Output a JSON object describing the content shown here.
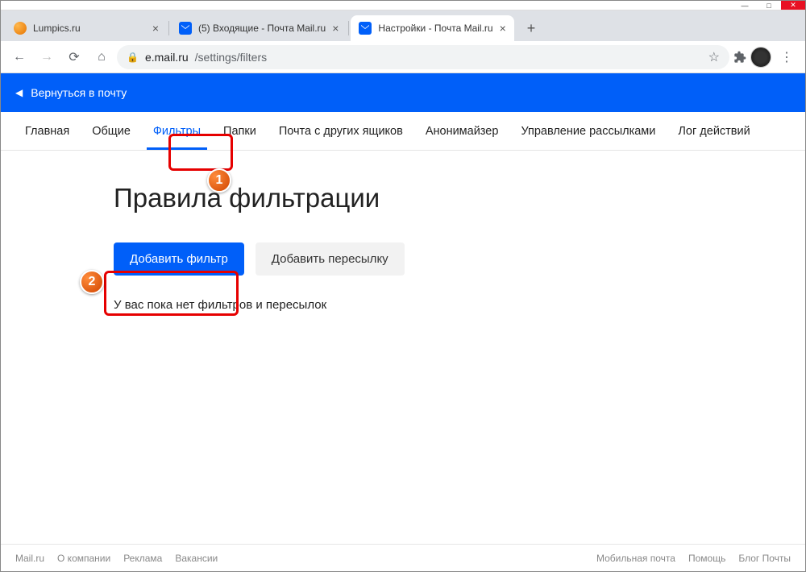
{
  "window": {
    "minimize": "—",
    "maximize": "□",
    "close": "✕"
  },
  "tabs": [
    {
      "title": "Lumpics.ru",
      "favicon": "orange",
      "active": false
    },
    {
      "title": "(5) Входящие - Почта Mail.ru",
      "favicon": "mail",
      "active": false
    },
    {
      "title": "Настройки - Почта Mail.ru",
      "favicon": "mail",
      "active": true
    }
  ],
  "newtab_label": "+",
  "address": {
    "host": "e.mail.ru",
    "path": "/settings/filters",
    "star": "☆"
  },
  "blueheader": {
    "arrow": "◀",
    "label": "Вернуться в почту"
  },
  "settings_tabs": [
    "Главная",
    "Общие",
    "Фильтры",
    "Папки",
    "Почта с других ящиков",
    "Анонимайзер",
    "Управление рассылками",
    "Лог действий"
  ],
  "settings_tabs_active_index": 2,
  "page": {
    "title": "Правила фильтрации",
    "add_filter": "Добавить фильтр",
    "add_forward": "Добавить пересылку",
    "empty": "У вас пока нет фильтров и пересылок"
  },
  "steps": {
    "one": "1",
    "two": "2"
  },
  "footer": {
    "left": [
      "Mail.ru",
      "О компании",
      "Реклама",
      "Вакансии"
    ],
    "right": [
      "Мобильная почта",
      "Помощь",
      "Блог Почты"
    ]
  }
}
